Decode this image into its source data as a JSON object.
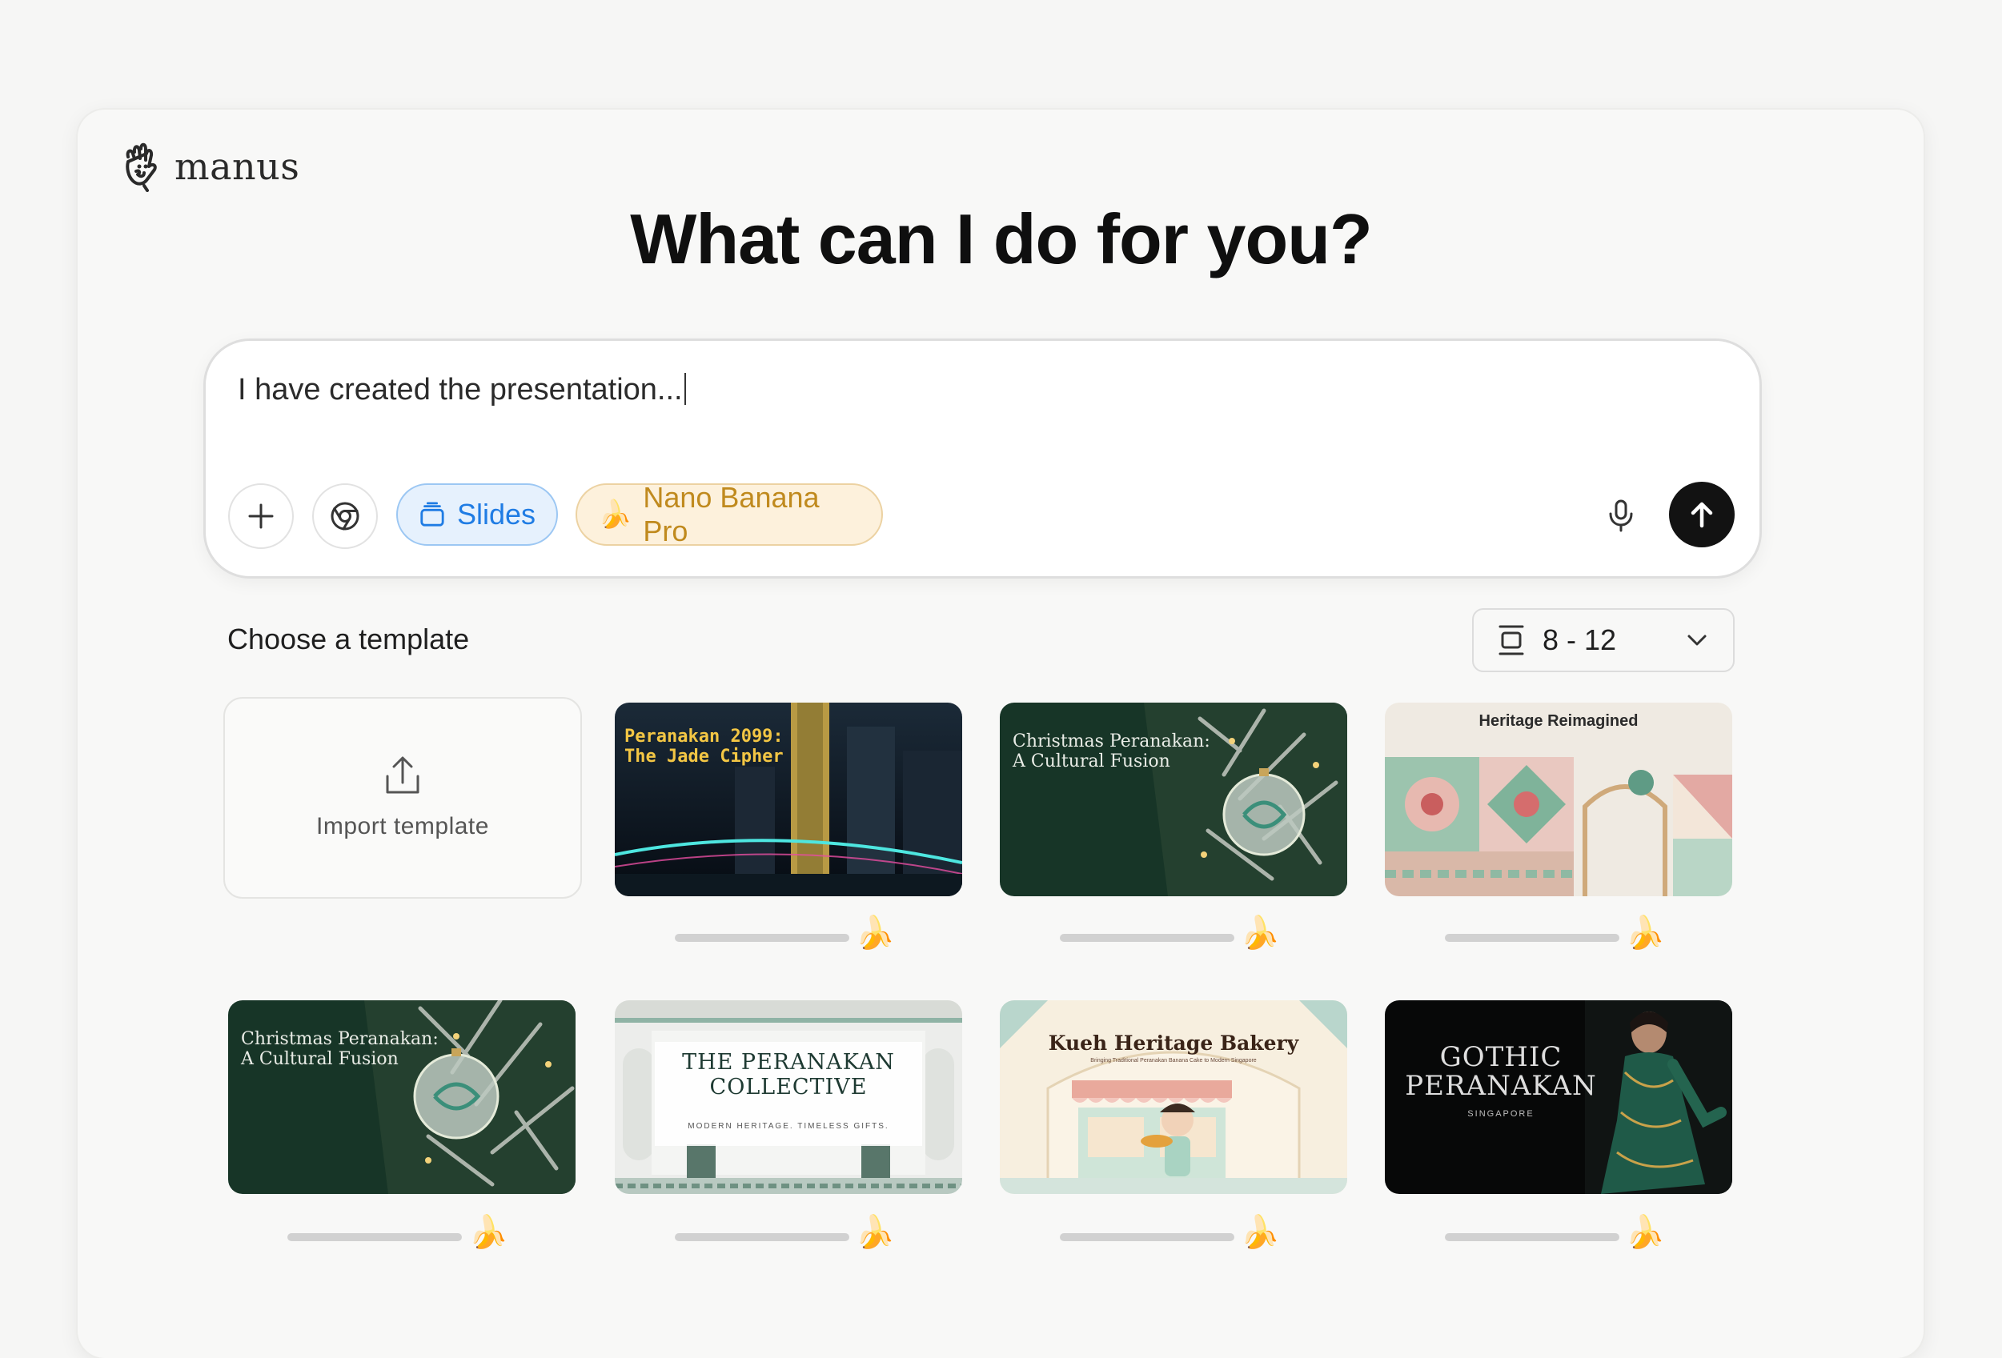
{
  "app": {
    "name": "manus"
  },
  "headline": "What can I do for you?",
  "composer": {
    "text": "I have created the presentation...",
    "chips": [
      {
        "label": "Slides",
        "icon": "slides-icon"
      },
      {
        "label": "Nano Banana Pro",
        "icon": "banana-emoji"
      }
    ]
  },
  "templates": {
    "section_title": "Choose a template",
    "slide_count": "8 - 12",
    "import_label": "Import template",
    "items": [
      {
        "title": "Peranakan 2099:\nThe Jade Cipher",
        "badge": "🍌"
      },
      {
        "title": "Christmas Peranakan:\nA Cultural Fusion",
        "badge": "🍌"
      },
      {
        "title": "Heritage Reimagined",
        "badge": "🍌"
      },
      {
        "title": "Christmas Peranakan:\nA Cultural Fusion",
        "badge": "🍌"
      },
      {
        "title": "THE PERANAKAN\nCOLLECTIVE",
        "subtitle": "MODERN HERITAGE. TIMELESS GIFTS.",
        "badge": "🍌"
      },
      {
        "title": "Kueh Heritage Bakery",
        "subtitle": "Bringing Traditional Peranakan Banana Cake to Modern Singapore",
        "badge": "🍌"
      },
      {
        "title": "GOTHIC\nPERANAKAN",
        "subtitle": "SINGAPORE",
        "badge": "🍌"
      },
      {
        "badge": "🍌"
      }
    ]
  },
  "colors": {
    "accent_blue": "#1f7ce4",
    "accent_gold": "#c08a1e",
    "send_button": "#121212"
  }
}
